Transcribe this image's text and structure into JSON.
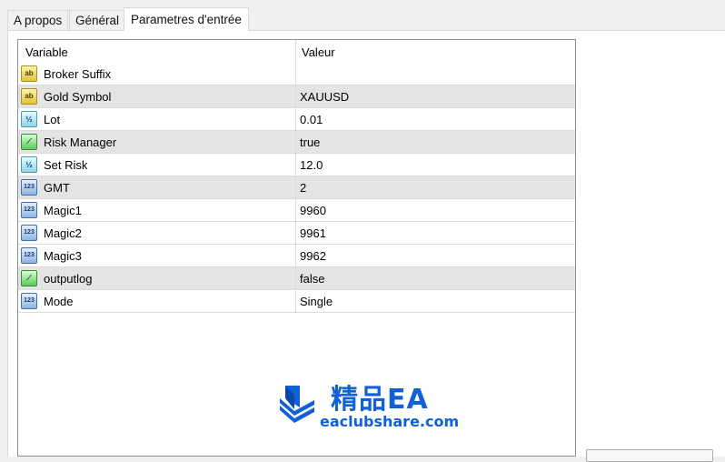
{
  "tabs": [
    {
      "label": "A propos"
    },
    {
      "label": "Général"
    },
    {
      "label": "Parametres d'entrée"
    }
  ],
  "grid": {
    "columns": {
      "variable": "Variable",
      "value": "Valeur"
    },
    "rows": [
      {
        "name": "Broker Suffix",
        "value": "",
        "icon": "string-type-icon",
        "glyph": "ab"
      },
      {
        "name": "Gold Symbol",
        "value": "XAUUSD",
        "icon": "string-type-icon",
        "glyph": "ab"
      },
      {
        "name": "Lot",
        "value": "0.01",
        "icon": "double-type-icon",
        "glyph": "½"
      },
      {
        "name": "Risk Manager",
        "value": "true",
        "icon": "bool-type-icon",
        "glyph": "⟋"
      },
      {
        "name": "Set Risk",
        "value": "12.0",
        "icon": "double-type-icon",
        "glyph": "½"
      },
      {
        "name": "GMT",
        "value": "2",
        "icon": "int-type-icon",
        "glyph": "123"
      },
      {
        "name": "Magic1",
        "value": "9960",
        "icon": "int-type-icon",
        "glyph": "123"
      },
      {
        "name": "Magic2",
        "value": "9961",
        "icon": "int-type-icon",
        "glyph": "123"
      },
      {
        "name": "Magic3",
        "value": "9962",
        "icon": "int-type-icon",
        "glyph": "123"
      },
      {
        "name": "outputlog",
        "value": "false",
        "icon": "bool-type-icon",
        "glyph": "⟋"
      },
      {
        "name": "Mode",
        "value": "Single",
        "icon": "int-type-icon",
        "glyph": "123"
      }
    ]
  },
  "watermark": {
    "title": "精品EA",
    "url": "eaclubshare.com",
    "color": "#1060d8"
  }
}
